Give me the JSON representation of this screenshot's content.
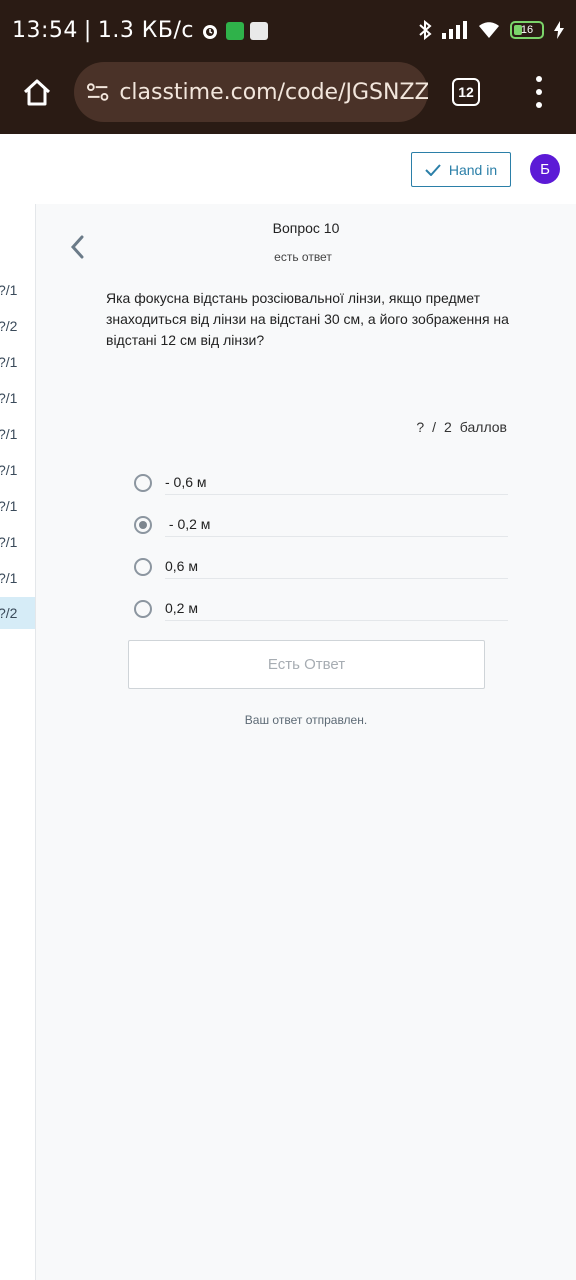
{
  "status_bar": {
    "time": "13:54",
    "separator": "|",
    "speed": "1.3 КБ/с",
    "battery": "16"
  },
  "browser": {
    "url": "classtime.com/code/JGSNZZ/",
    "tab_count": "12"
  },
  "header": {
    "hand_in_label": "Hand in",
    "avatar_initial": "Б"
  },
  "rail": {
    "items": [
      "?/1",
      "?/2",
      "?/1",
      "?/1",
      "?/1",
      "?/1",
      "?/1",
      "?/1",
      "?/1",
      "?/2"
    ],
    "active_index": 9
  },
  "question": {
    "title": "Вопрос 10",
    "status": "есть ответ",
    "text": "Яка фокусна відстань розсіювальної лінзи, якщо предмет знаходиться від лінзи на відстані 30 см, а його зображення на відстані 12 см від лінзи?",
    "points": {
      "earned": "?",
      "sep": "/",
      "max": "2",
      "unit": "баллов"
    },
    "options": [
      {
        "label": "- 0,6 м",
        "checked": false
      },
      {
        "label": " - 0,2 м",
        "checked": true
      },
      {
        "label": "0,6 м",
        "checked": false
      },
      {
        "label": "0,2 м",
        "checked": false
      }
    ],
    "submit_label": "Есть Ответ",
    "sent_message": "Ваш ответ отправлен."
  },
  "colors": {
    "browser_bg": "#2a1b14",
    "url_bg": "#4a3228",
    "accent": "#2b7fa8",
    "avatar": "#5c1ad6",
    "rail_active": "#d6ecf7"
  }
}
